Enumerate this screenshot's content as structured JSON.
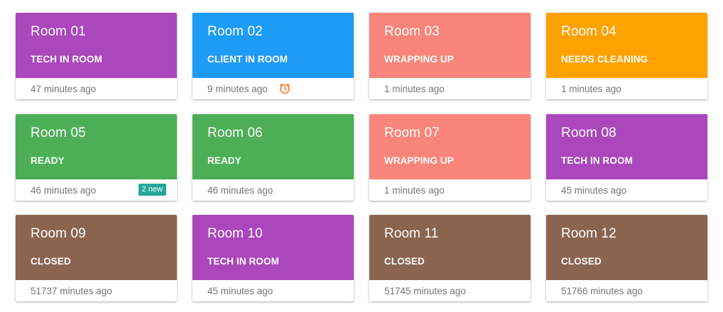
{
  "colors": {
    "tech": "#ab47bc",
    "client": "#1e9bf5",
    "wrapping": "#f9857a",
    "cleaning": "#ffa200",
    "ready": "#4caf57",
    "closed": "#8b6450",
    "badge": "#26a69a",
    "timer_icon": "#f57c2a"
  },
  "rooms": [
    {
      "name": "Room 01",
      "status": "TECH IN ROOM",
      "time": "47 minutes ago",
      "color": "#ab47bc"
    },
    {
      "name": "Room 02",
      "status": "CLIENT IN ROOM",
      "time": "9 minutes ago",
      "color": "#1e9bf5",
      "icon": "timer-icon"
    },
    {
      "name": "Room 03",
      "status": "WRAPPING UP",
      "time": "1 minutes ago",
      "color": "#f9857a"
    },
    {
      "name": "Room 04",
      "status": "NEEDS CLEANING",
      "time": "1 minutes ago",
      "color": "#ffa200"
    },
    {
      "name": "Room 05",
      "status": "READY",
      "time": "46 minutes ago",
      "color": "#4caf57",
      "badge": "2 new"
    },
    {
      "name": "Room 06",
      "status": "READY",
      "time": "46 minutes ago",
      "color": "#4caf57"
    },
    {
      "name": "Room 07",
      "status": "WRAPPING UP",
      "time": "1 minutes ago",
      "color": "#f9857a"
    },
    {
      "name": "Room 08",
      "status": "TECH IN ROOM",
      "time": "45 minutes ago",
      "color": "#ab47bc"
    },
    {
      "name": "Room 09",
      "status": "CLOSED",
      "time": "51737 minutes ago",
      "color": "#8b6450"
    },
    {
      "name": "Room 10",
      "status": "TECH IN ROOM",
      "time": "45 minutes ago",
      "color": "#ab47bc"
    },
    {
      "name": "Room 11",
      "status": "CLOSED",
      "time": "51745 minutes ago",
      "color": "#8b6450"
    },
    {
      "name": "Room 12",
      "status": "CLOSED",
      "time": "51766 minutes ago",
      "color": "#8b6450"
    }
  ]
}
